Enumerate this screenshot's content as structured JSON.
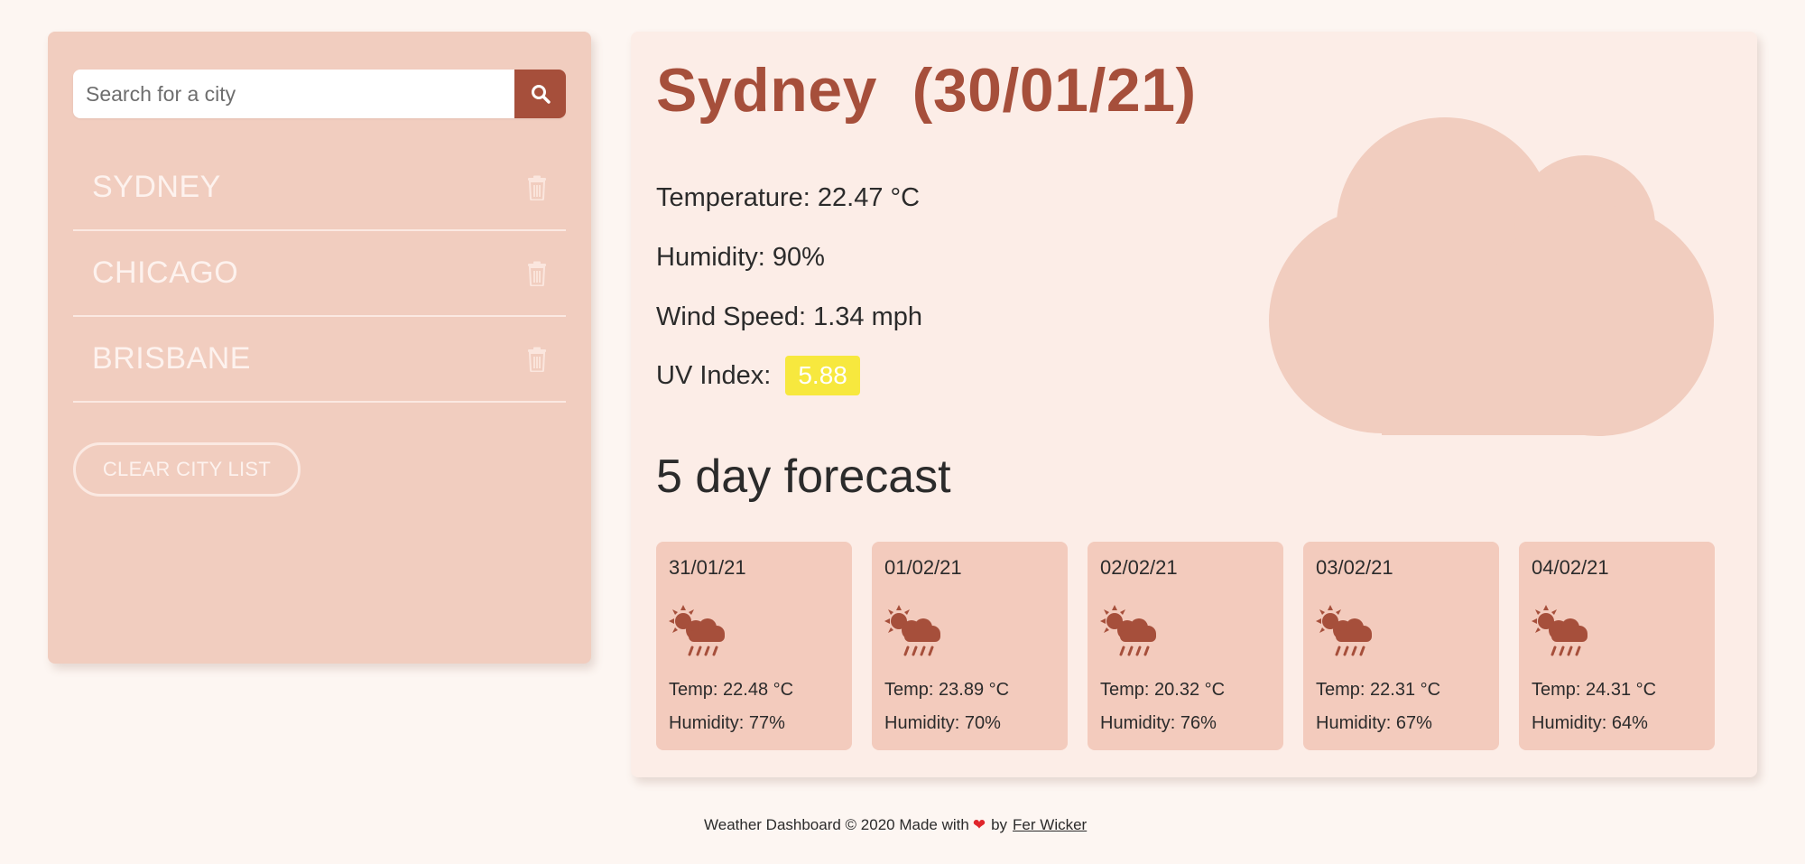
{
  "sidebar": {
    "search": {
      "placeholder": "Search for a city",
      "value": ""
    },
    "search_button_icon": "search-icon",
    "cities": [
      {
        "name": "SYDNEY",
        "delete_icon": "trash-icon"
      },
      {
        "name": "CHICAGO",
        "delete_icon": "trash-icon"
      },
      {
        "name": "BRISBANE",
        "delete_icon": "trash-icon"
      }
    ],
    "clear_label": "CLEAR CITY LIST"
  },
  "current": {
    "title": "Sydney  (30/01/21)",
    "temperature": "Temperature: 22.47 °C",
    "humidity": "Humidity: 90%",
    "wind": "Wind Speed: 1.34 mph",
    "uv_label": "UV Index:",
    "uv_value": "5.88",
    "icon": "cloud-icon"
  },
  "forecast": {
    "heading": "5 day forecast",
    "days": [
      {
        "date": "31/01/21",
        "icon": "sun-cloud-rain-icon",
        "temp": "Temp: 22.48 °C",
        "humidity": "Humidity: 77%"
      },
      {
        "date": "01/02/21",
        "icon": "sun-cloud-rain-icon",
        "temp": "Temp: 23.89 °C",
        "humidity": "Humidity: 70%"
      },
      {
        "date": "02/02/21",
        "icon": "sun-cloud-rain-icon",
        "temp": "Temp: 20.32 °C",
        "humidity": "Humidity: 76%"
      },
      {
        "date": "03/02/21",
        "icon": "sun-cloud-rain-icon",
        "temp": "Temp: 22.31 °C",
        "humidity": "Humidity: 67%"
      },
      {
        "date": "04/02/21",
        "icon": "sun-cloud-rain-icon",
        "temp": "Temp: 24.31 °C",
        "humidity": "Humidity: 64%"
      }
    ]
  },
  "footer": {
    "text": "Weather Dashboard © 2020 Made with",
    "heart_icon": "heart-icon",
    "by": "by",
    "author": "Fer Wicker"
  },
  "colors": {
    "page_bg": "#fdf6f2",
    "sidebar_bg": "#f1cdbf",
    "main_bg": "#fcede7",
    "accent": "#a64f3b",
    "card_bg": "#f3cbbd",
    "uv_badge": "#f7e83e",
    "cloud": "#f1cdbf"
  }
}
